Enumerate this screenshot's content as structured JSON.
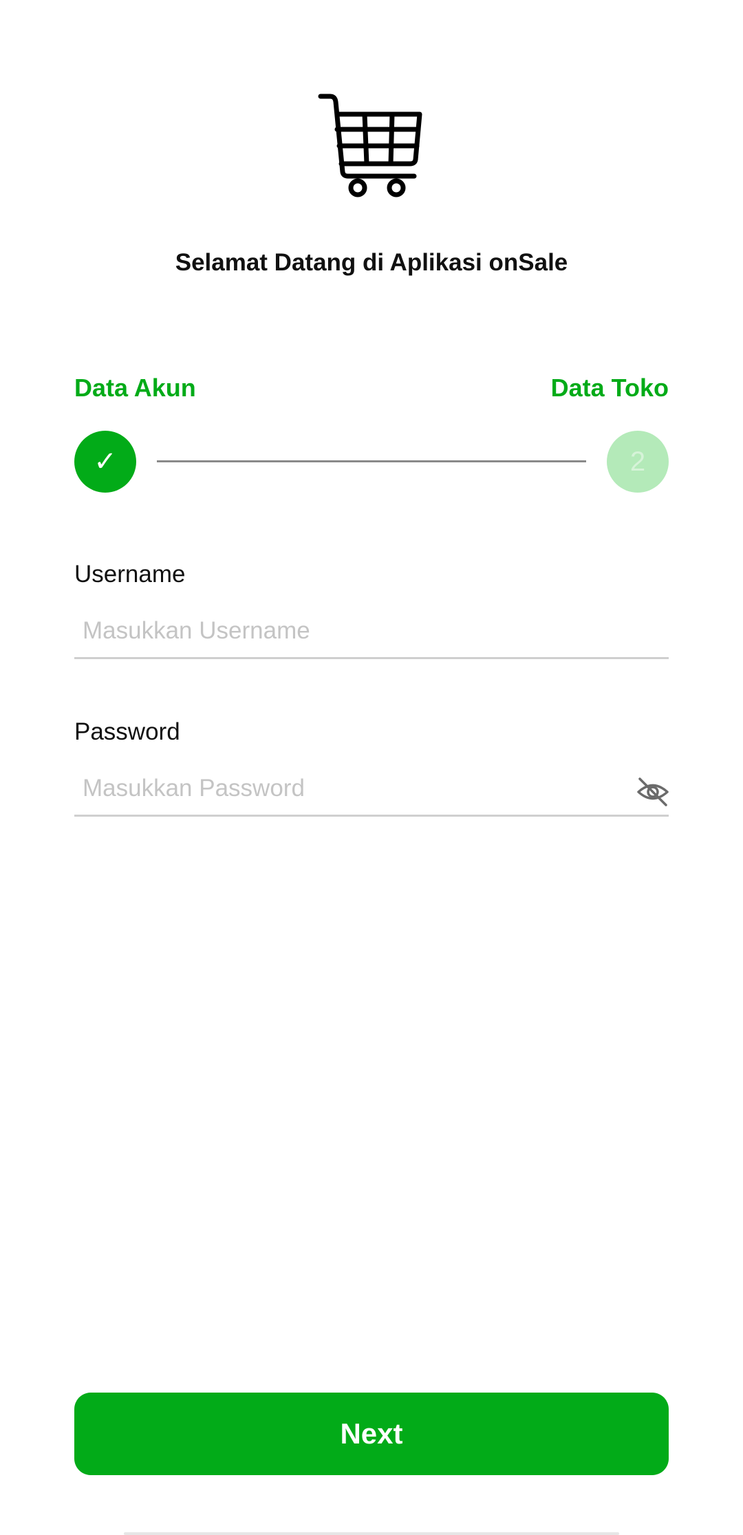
{
  "colors": {
    "accent": "#02ab18",
    "accent_light": "#b4eab9"
  },
  "header": {
    "logo_icon": "shopping-cart-icon",
    "welcome_text": "Selamat Datang di Aplikasi onSale"
  },
  "stepper": {
    "steps": [
      {
        "label": "Data Akun",
        "state": "completed",
        "indicator": "✓"
      },
      {
        "label": "Data Toko",
        "state": "pending",
        "indicator": "2"
      }
    ]
  },
  "form": {
    "username": {
      "label": "Username",
      "value": "",
      "placeholder": "Masukkan Username"
    },
    "password": {
      "label": "Password",
      "value": "",
      "placeholder": "Masukkan Password",
      "toggle_icon": "eye-off-icon"
    }
  },
  "actions": {
    "next_label": "Next"
  }
}
